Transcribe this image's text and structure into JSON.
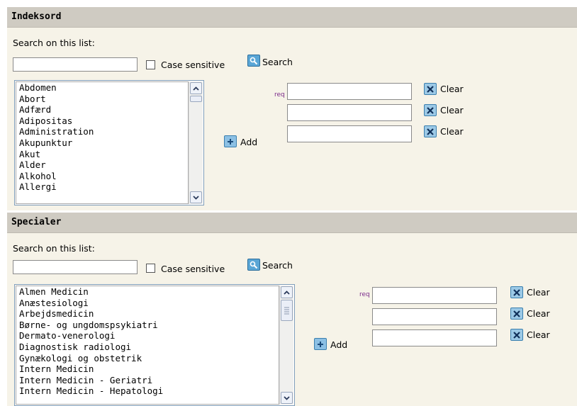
{
  "sections": [
    {
      "title": "Indeksord",
      "search_label": "Search on this list:",
      "search_value": "",
      "case_label": "Case sensitive",
      "search_button": "Search",
      "items": [
        "Abdomen",
        "Abort",
        "Adfærd",
        "Adipositas",
        "Administration",
        "Akupunktur",
        "Akut",
        "Alder",
        "Alkohol",
        "Allergi"
      ],
      "add_label": "Add",
      "req_label": "req",
      "clear_label": "Clear",
      "fields": [
        "",
        "",
        ""
      ]
    },
    {
      "title": "Specialer",
      "search_label": "Search on this list:",
      "search_value": "",
      "case_label": "Case sensitive",
      "search_button": "Search",
      "items": [
        "Almen Medicin",
        "Anæstesiologi",
        "Arbejdsmedicin",
        "Børne- og ungdomspsykiatri",
        "Dermato-venerologi",
        "Diagnostisk radiologi",
        "Gynækologi og obstetrik",
        "Intern Medicin",
        "Intern Medicin - Geriatri",
        "Intern Medicin - Hepatologi"
      ],
      "add_label": "Add",
      "req_label": "req",
      "clear_label": "Clear",
      "fields": [
        "",
        "",
        ""
      ]
    }
  ]
}
